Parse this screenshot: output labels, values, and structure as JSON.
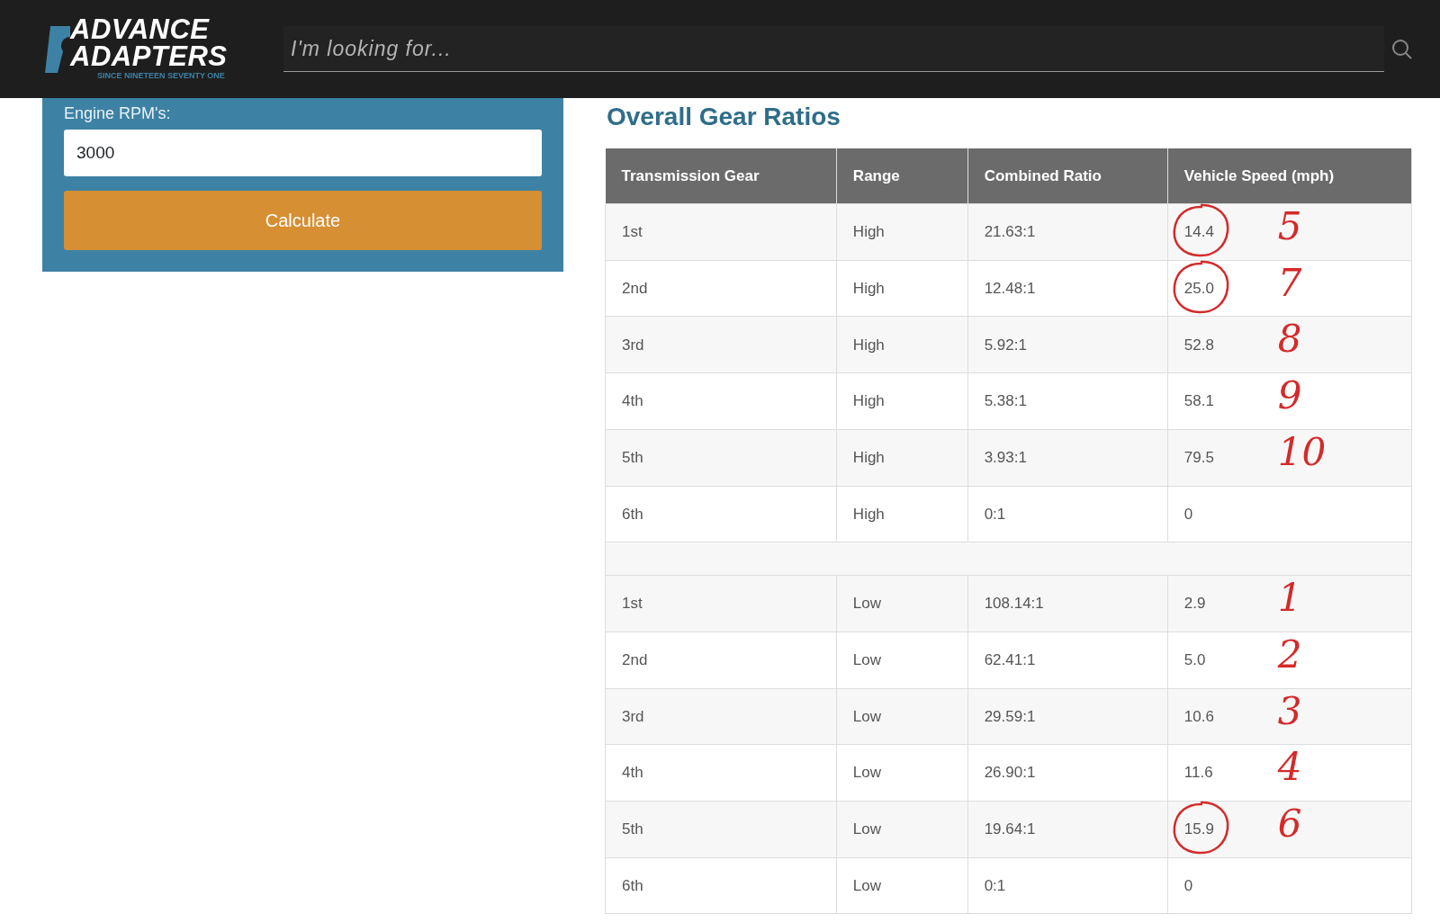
{
  "logo": {
    "line_1": "ADVANCE",
    "line_2": "ADAPTERS",
    "tagline": "SINCE NINETEEN SEVENTY ONE"
  },
  "search": {
    "placeholder": "I'm looking for..."
  },
  "calculator": {
    "label": "Engine RPM's:",
    "value": "3000",
    "button": "Calculate"
  },
  "table": {
    "title": "Overall Gear Ratios",
    "columns": [
      "Transmission Gear",
      "Range",
      "Combined Ratio",
      "Vehicle Speed (mph)"
    ],
    "rows": [
      {
        "kind": "data",
        "cells": [
          "1st",
          "High",
          "21.63:1",
          "14.4"
        ],
        "circled": true,
        "note": "5"
      },
      {
        "kind": "data",
        "cells": [
          "2nd",
          "High",
          "12.48:1",
          "25.0"
        ],
        "circled": true,
        "note": "7"
      },
      {
        "kind": "data",
        "cells": [
          "3rd",
          "High",
          "5.92:1",
          "52.8"
        ],
        "circled": false,
        "note": "8"
      },
      {
        "kind": "data",
        "cells": [
          "4th",
          "High",
          "5.38:1",
          "58.1"
        ],
        "circled": false,
        "note": "9"
      },
      {
        "kind": "data",
        "cells": [
          "5th",
          "High",
          "3.93:1",
          "79.5"
        ],
        "circled": false,
        "note": "10"
      },
      {
        "kind": "data",
        "cells": [
          "6th",
          "High",
          "0:1",
          "0"
        ],
        "circled": false
      },
      {
        "kind": "spacer"
      },
      {
        "kind": "data",
        "cells": [
          "1st",
          "Low",
          "108.14:1",
          "2.9"
        ],
        "circled": false,
        "note": "1"
      },
      {
        "kind": "data",
        "cells": [
          "2nd",
          "Low",
          "62.41:1",
          "5.0"
        ],
        "circled": false,
        "note": "2"
      },
      {
        "kind": "data",
        "cells": [
          "3rd",
          "Low",
          "29.59:1",
          "10.6"
        ],
        "circled": false,
        "note": "3"
      },
      {
        "kind": "data",
        "cells": [
          "4th",
          "Low",
          "26.90:1",
          "11.6"
        ],
        "circled": false,
        "note": "4"
      },
      {
        "kind": "data",
        "cells": [
          "5th",
          "Low",
          "19.64:1",
          "15.9"
        ],
        "circled": true,
        "note": "6"
      },
      {
        "kind": "data",
        "cells": [
          "6th",
          "Low",
          "0:1",
          "0"
        ],
        "circled": false
      }
    ]
  }
}
